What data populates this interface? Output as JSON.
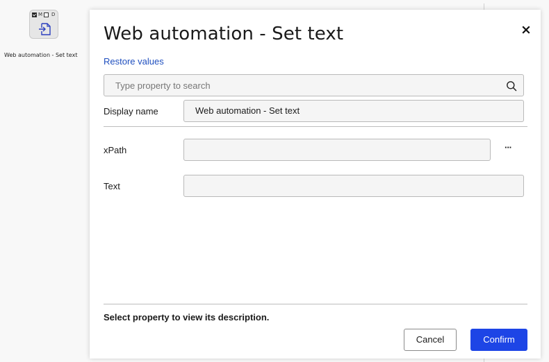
{
  "canvas": {
    "node": {
      "flag_m": "M",
      "flag_d": "D",
      "label": "Web automation - Set text",
      "icon": "document-arrow-in-icon"
    }
  },
  "dialog": {
    "title": "Web automation - Set text",
    "restore_label": "Restore values",
    "search": {
      "placeholder": "Type property to search",
      "value": ""
    },
    "fields": {
      "display_name": {
        "label": "Display name",
        "value": "Web automation - Set text"
      },
      "xpath": {
        "label": "xPath",
        "value": "",
        "more": "···"
      },
      "text": {
        "label": "Text",
        "value": ""
      }
    },
    "description": "Select property to view its description.",
    "cancel_label": "Cancel",
    "confirm_label": "Confirm"
  },
  "colors": {
    "accent": "#1d45e6",
    "link": "#1f4fbf"
  }
}
